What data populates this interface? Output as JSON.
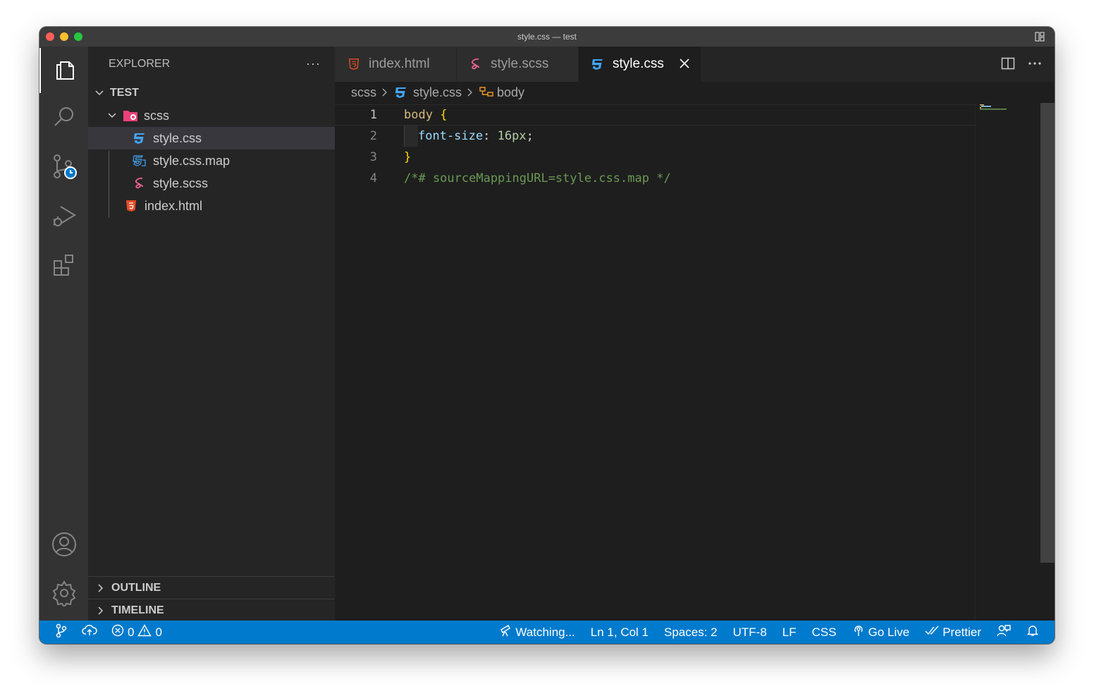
{
  "window": {
    "title": "style.css — test"
  },
  "sidebar": {
    "header": "EXPLORER",
    "more": "···",
    "root": "TEST",
    "tree": {
      "folder": "scss",
      "files": [
        "style.css",
        "style.css.map",
        "style.scss"
      ],
      "root_file": "index.html"
    },
    "sections": [
      "OUTLINE",
      "TIMELINE"
    ]
  },
  "tabs": [
    {
      "label": "index.html",
      "icon": "html5-icon"
    },
    {
      "label": "style.scss",
      "icon": "sass-icon"
    },
    {
      "label": "style.css",
      "icon": "css3-icon",
      "active": true
    }
  ],
  "breadcrumb": [
    "scss",
    "style.css",
    "body"
  ],
  "editor": {
    "current_line": 1,
    "lines": [
      {
        "num": "1",
        "selector": "body",
        "brace": "{"
      },
      {
        "num": "2",
        "property": "font-size",
        "colon": ": ",
        "value": "16px",
        "semi": ";"
      },
      {
        "num": "3",
        "brace": "}"
      },
      {
        "num": "4",
        "comment": "/*# sourceMappingURL=style.css.map */"
      }
    ]
  },
  "statusbar": {
    "errors": "0",
    "warnings": "0",
    "watching": "Watching...",
    "position": "Ln 1, Col 1",
    "spaces": "Spaces: 2",
    "encoding": "UTF-8",
    "eol": "LF",
    "language": "CSS",
    "golive": "Go Live",
    "prettier": "Prettier"
  },
  "colors": {
    "statusbar": "#007acc",
    "activity_bar": "#333333",
    "sidebar": "#252526",
    "editor": "#1e1e1e",
    "html_icon": "#e44d26",
    "css_icon": "#42a5f5",
    "sass_icon": "#f06292"
  }
}
